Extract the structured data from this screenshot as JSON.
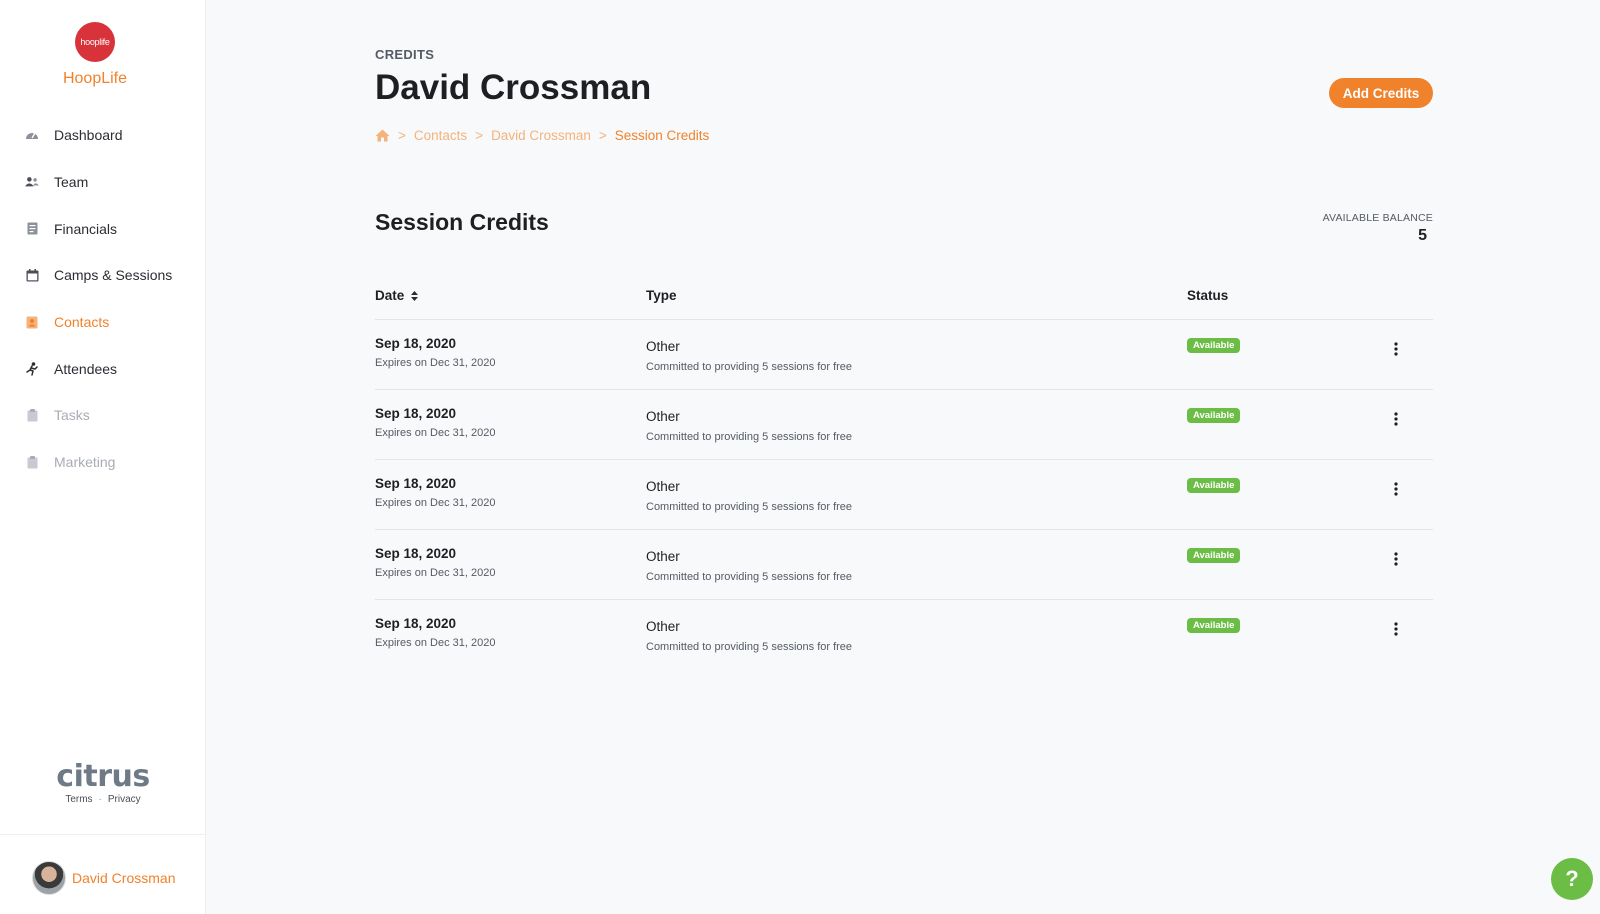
{
  "brand": {
    "logo_text": "hooplife",
    "name": "HoopLife"
  },
  "nav": [
    {
      "label": "Dashboard",
      "icon": "speedometer-icon",
      "state": "normal"
    },
    {
      "label": "Team",
      "icon": "users-icon",
      "state": "normal"
    },
    {
      "label": "Financials",
      "icon": "document-icon",
      "state": "normal"
    },
    {
      "label": "Camps & Sessions",
      "icon": "calendar-icon",
      "state": "normal"
    },
    {
      "label": "Contacts",
      "icon": "contact-card-icon",
      "state": "active"
    },
    {
      "label": "Attendees",
      "icon": "runner-icon",
      "state": "normal"
    },
    {
      "label": "Tasks",
      "icon": "clipboard-icon",
      "state": "disabled"
    },
    {
      "label": "Marketing",
      "icon": "clipboard-icon",
      "state": "disabled"
    }
  ],
  "footer": {
    "logo": "citrus",
    "terms": "Terms",
    "separator": "·",
    "privacy": "Privacy"
  },
  "user": {
    "name": "David Crossman"
  },
  "header": {
    "eyebrow": "CREDITS",
    "title": "David Crossman",
    "add_button": "Add Credits"
  },
  "breadcrumb": {
    "separator": ">",
    "items": [
      "Contacts",
      "David Crossman",
      "Session Credits"
    ]
  },
  "section": {
    "title": "Session Credits",
    "balance_label": "AVAILABLE BALANCE",
    "balance_value": "5"
  },
  "table": {
    "columns": {
      "date": "Date",
      "type": "Type",
      "status": "Status"
    },
    "rows": [
      {
        "date": "Sep 18, 2020",
        "expires": "Expires on Dec 31, 2020",
        "type": "Other",
        "description": "Committed to providing 5 sessions for free",
        "status": "Available"
      },
      {
        "date": "Sep 18, 2020",
        "expires": "Expires on Dec 31, 2020",
        "type": "Other",
        "description": "Committed to providing 5 sessions for free",
        "status": "Available"
      },
      {
        "date": "Sep 18, 2020",
        "expires": "Expires on Dec 31, 2020",
        "type": "Other",
        "description": "Committed to providing 5 sessions for free",
        "status": "Available"
      },
      {
        "date": "Sep 18, 2020",
        "expires": "Expires on Dec 31, 2020",
        "type": "Other",
        "description": "Committed to providing 5 sessions for free",
        "status": "Available"
      },
      {
        "date": "Sep 18, 2020",
        "expires": "Expires on Dec 31, 2020",
        "type": "Other",
        "description": "Committed to providing 5 sessions for free",
        "status": "Available"
      }
    ]
  },
  "help": {
    "label": "?"
  },
  "colors": {
    "accent": "#f0822c",
    "success": "#6bbd45",
    "brand_red": "#d8323a"
  }
}
